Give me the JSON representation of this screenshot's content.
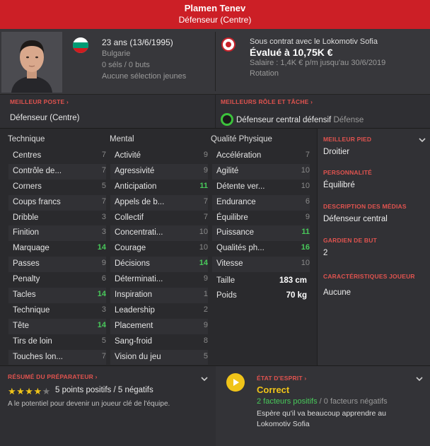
{
  "header": {
    "name": "Plamen Tenev",
    "position": "Défenseur (Centre)"
  },
  "bio": {
    "age_line": "23 ans (13/6/1995)",
    "nationality": "Bulgarie",
    "caps": "0 séls / 0 buts",
    "youth": "Aucune sélection jeunes"
  },
  "contract": {
    "line": "Sous contrat avec le Lokomotiv Sofia",
    "value": "Évalué à 10,75K €",
    "salary": "Salaire : 1,4K € p/m jusqu'au 30/6/2019",
    "status": "Rotation"
  },
  "best_position": {
    "title": "MEILLEUR POSTE ›",
    "value": "Défenseur (Centre)"
  },
  "best_role": {
    "title": "MEILLEURS RÔLE ET TÂCHE ›",
    "role": "Défenseur central défensif",
    "duty": "Défense"
  },
  "columns": {
    "technical": "Technique",
    "mental": "Mental",
    "physical": "Qualité Physique"
  },
  "technical": [
    {
      "label": "Centres",
      "value": "7"
    },
    {
      "label": "Contrôle de...",
      "value": "7"
    },
    {
      "label": "Corners",
      "value": "5"
    },
    {
      "label": "Coups francs",
      "value": "7"
    },
    {
      "label": "Dribble",
      "value": "3"
    },
    {
      "label": "Finition",
      "value": "3"
    },
    {
      "label": "Marquage",
      "value": "14"
    },
    {
      "label": "Passes",
      "value": "9"
    },
    {
      "label": "Penalty",
      "value": "6"
    },
    {
      "label": "Tacles",
      "value": "14"
    },
    {
      "label": "Technique",
      "value": "3"
    },
    {
      "label": "Tête",
      "value": "14"
    },
    {
      "label": "Tirs de loin",
      "value": "5"
    },
    {
      "label": "Touches lon...",
      "value": "7"
    }
  ],
  "mental": [
    {
      "label": "Activité",
      "value": "9"
    },
    {
      "label": "Agressivité",
      "value": "9"
    },
    {
      "label": "Anticipation",
      "value": "11"
    },
    {
      "label": "Appels de b...",
      "value": "7"
    },
    {
      "label": "Collectif",
      "value": "7"
    },
    {
      "label": "Concentrati...",
      "value": "10"
    },
    {
      "label": "Courage",
      "value": "10"
    },
    {
      "label": "Décisions",
      "value": "14"
    },
    {
      "label": "Déterminati...",
      "value": "9"
    },
    {
      "label": "Inspiration",
      "value": "1"
    },
    {
      "label": "Leadership",
      "value": "2"
    },
    {
      "label": "Placement",
      "value": "9"
    },
    {
      "label": "Sang-froid",
      "value": "8"
    },
    {
      "label": "Vision du jeu",
      "value": "5"
    }
  ],
  "physical": [
    {
      "label": "Accélération",
      "value": "7"
    },
    {
      "label": "Agilité",
      "value": "10"
    },
    {
      "label": "Détente ver...",
      "value": "10"
    },
    {
      "label": "Endurance",
      "value": "6"
    },
    {
      "label": "Équilibre",
      "value": "9"
    },
    {
      "label": "Puissance",
      "value": "11"
    },
    {
      "label": "Qualités ph...",
      "value": "16"
    },
    {
      "label": "Vitesse",
      "value": "10"
    }
  ],
  "body": {
    "height_label": "Taille",
    "height": "183 cm",
    "weight_label": "Poids",
    "weight": "70 kg"
  },
  "side": {
    "foot_title": "MEILLEUR PIED",
    "foot": "Droitier",
    "personality_title": "PERSONNALITÉ",
    "personality": "Équilibré",
    "media_title": "DESCRIPTION DES MÉDIAS",
    "media": "Défenseur central",
    "gk_title": "GARDIEN DE BUT",
    "gk": "2",
    "traits_title": "CARACTÉRISTIQUES JOUEUR",
    "traits": "Aucune"
  },
  "trainer": {
    "title": "RÉSUMÉ DU PRÉPARATEUR ›",
    "stars_on": "★★★★",
    "stars_off": "★",
    "summary": "5 points positifs / 5 négatifs",
    "note": "A le potentiel pour devenir un joueur clé de l'équipe."
  },
  "mood": {
    "title": "ÉTAT D'ESPRIT ›",
    "value": "Correct",
    "positive": "2 facteurs positifs",
    "separator": " / ",
    "negative": "0 facteurs négatifs",
    "note": "Espère qu'il va beaucoup apprendre au Lokomotiv Sofia"
  },
  "colors": {
    "header_red": "#cc1f26",
    "accent_red": "#e0534f",
    "high_green": "#48c85a",
    "mood_yellow": "#f0c419"
  }
}
